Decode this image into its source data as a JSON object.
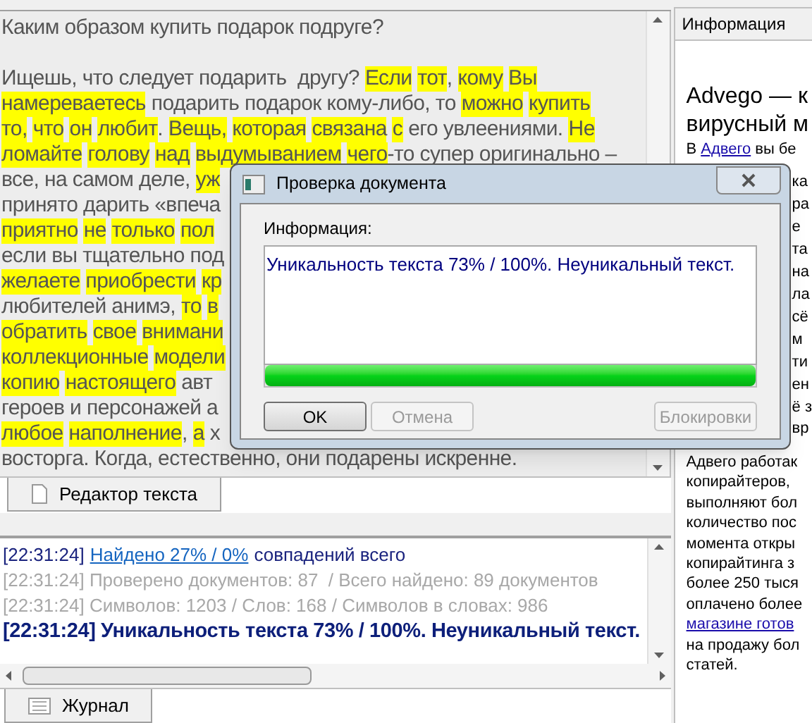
{
  "editor": {
    "title": "Каким образом купить подарок подруге?",
    "lines": [
      [
        {
          "text": "Ищешь, что следует подарить  другу?",
          "highlighted": false
        },
        {
          "text": "Если",
          "highlighted": true
        },
        {
          "text": "тот",
          "highlighted": true
        },
        {
          "text": ",",
          "highlighted": false,
          "attached": true
        },
        {
          "text": "кому",
          "highlighted": true
        },
        {
          "text": "Вы",
          "highlighted": true
        }
      ],
      [
        {
          "text": "намереваетесь",
          "highlighted": true
        },
        {
          "text": "подарить подарок кому-либо, то",
          "highlighted": false
        },
        {
          "text": "можно",
          "highlighted": true
        },
        {
          "text": "купить",
          "highlighted": true
        }
      ],
      [
        {
          "text": "то,",
          "highlighted": true
        },
        {
          "text": "что",
          "highlighted": true
        },
        {
          "text": "он",
          "highlighted": true
        },
        {
          "text": "любит",
          "highlighted": true
        },
        {
          "text": ".",
          "highlighted": false,
          "attached": true
        },
        {
          "text": "Вещь,",
          "highlighted": true
        },
        {
          "text": "которая",
          "highlighted": true
        },
        {
          "text": "связана",
          "highlighted": true
        },
        {
          "text": "с",
          "highlighted": true
        },
        {
          "text": "его увлеениями.",
          "highlighted": false
        },
        {
          "text": "Не",
          "highlighted": true
        }
      ],
      [
        {
          "text": "ломайте",
          "highlighted": true
        },
        {
          "text": "голову",
          "highlighted": true
        },
        {
          "text": "над",
          "highlighted": true
        },
        {
          "text": "выдумыванием",
          "highlighted": true
        },
        {
          "text": "чего",
          "highlighted": true
        },
        {
          "text": "-то супер оригинально –",
          "highlighted": false,
          "attached": true
        }
      ],
      [
        {
          "text": "все, на самом деле,",
          "highlighted": false
        },
        {
          "text": "уж",
          "highlighted": true
        }
      ],
      [
        {
          "text": "принято дарить «впеча",
          "highlighted": false
        }
      ],
      [
        {
          "text": "приятно",
          "highlighted": true
        },
        {
          "text": "не",
          "highlighted": true
        },
        {
          "text": "только",
          "highlighted": true
        },
        {
          "text": "пол",
          "highlighted": true
        }
      ],
      [
        {
          "text": "если вы тщательно под",
          "highlighted": false
        }
      ],
      [
        {
          "text": "желаете",
          "highlighted": true
        },
        {
          "text": "приобрести",
          "highlighted": true
        },
        {
          "text": "кр",
          "highlighted": true
        }
      ],
      [
        {
          "text": "любителей анимэ,",
          "highlighted": false
        },
        {
          "text": "то",
          "highlighted": true
        },
        {
          "text": "в",
          "highlighted": true
        }
      ],
      [
        {
          "text": "обратить",
          "highlighted": true
        },
        {
          "text": "свое",
          "highlighted": true
        },
        {
          "text": "внимани",
          "highlighted": true
        }
      ],
      [
        {
          "text": "коллекционные",
          "highlighted": true
        },
        {
          "text": "модели",
          "highlighted": true
        }
      ],
      [
        {
          "text": "копию",
          "highlighted": true
        },
        {
          "text": "настоящего",
          "highlighted": true
        },
        {
          "text": "авт",
          "highlighted": false
        }
      ],
      [
        {
          "text": "героев и персонажей а",
          "highlighted": false
        }
      ],
      [
        {
          "text": "любое",
          "highlighted": true
        },
        {
          "text": "наполнение",
          "highlighted": true
        },
        {
          "text": ",",
          "highlighted": false,
          "attached": true
        },
        {
          "text": "а",
          "highlighted": true
        },
        {
          "text": "х",
          "highlighted": false
        }
      ],
      [
        {
          "text": "восторга. Когда, естественно, они подарены искренне.",
          "highlighted": false
        }
      ]
    ]
  },
  "editor_tab": {
    "label": "Редактор текста",
    "selected": true
  },
  "log": {
    "lines": [
      {
        "kind": "link",
        "time": "[22:31:24]",
        "link": "Найдено 27% / 0%",
        "text": "совпадений всего"
      },
      {
        "kind": "info",
        "text": "[22:31:24] Проверено документов: 87  / Всего найдено: 89 документов"
      },
      {
        "kind": "info",
        "text": "[22:31:24] Символов: 1203 / Слов: 168 / Символов в словах: 986"
      },
      {
        "kind": "result",
        "text": "[22:31:24] Уникальность текста 73% / 100%. Неуникальный текст."
      }
    ]
  },
  "log_tab": {
    "label": "Журнал",
    "selected": true
  },
  "info_panel": {
    "tab": {
      "label": "Информация",
      "selected": true
    },
    "heading": [
      "Advego — к",
      "вирусный м"
    ],
    "top_line": {
      "prefix": "В",
      "link": "Адвего",
      "text": "вы бе"
    },
    "side_fragments": [
      "ка",
      "ра",
      "е",
      "та",
      "на",
      "ла",
      "сё",
      "м",
      "ти",
      "ен",
      "ё з"
    ],
    "after_fragment": "вр",
    "body": [
      {
        "kind": "text",
        "text": "Адвего работак"
      },
      {
        "kind": "text",
        "text": "копирайтеров,"
      },
      {
        "kind": "text",
        "text": "выполняют бол"
      },
      {
        "kind": "text",
        "text": "количество пос"
      },
      {
        "kind": "text",
        "text": "момента откры"
      },
      {
        "kind": "text",
        "text": "копирайтинга з"
      },
      {
        "kind": "text",
        "text": "более 250 тыся"
      },
      {
        "kind": "text",
        "text": "оплачено более"
      },
      {
        "kind": "link",
        "text": "магазине готов"
      },
      {
        "kind": "text",
        "text": "на продажу бол"
      },
      {
        "kind": "text",
        "text": "статей."
      }
    ]
  },
  "dialog": {
    "title": "Проверка документа",
    "label": "Информация:",
    "message": "Уникальность текста 73% / 100%. Неуникальный текст.",
    "progress": {
      "level": 1
    },
    "buttons": [
      {
        "label": "OK",
        "disabled": false
      },
      {
        "label": "Отмена",
        "disabled": true
      },
      {
        "label": "Блокировки",
        "disabled": true
      }
    ]
  }
}
